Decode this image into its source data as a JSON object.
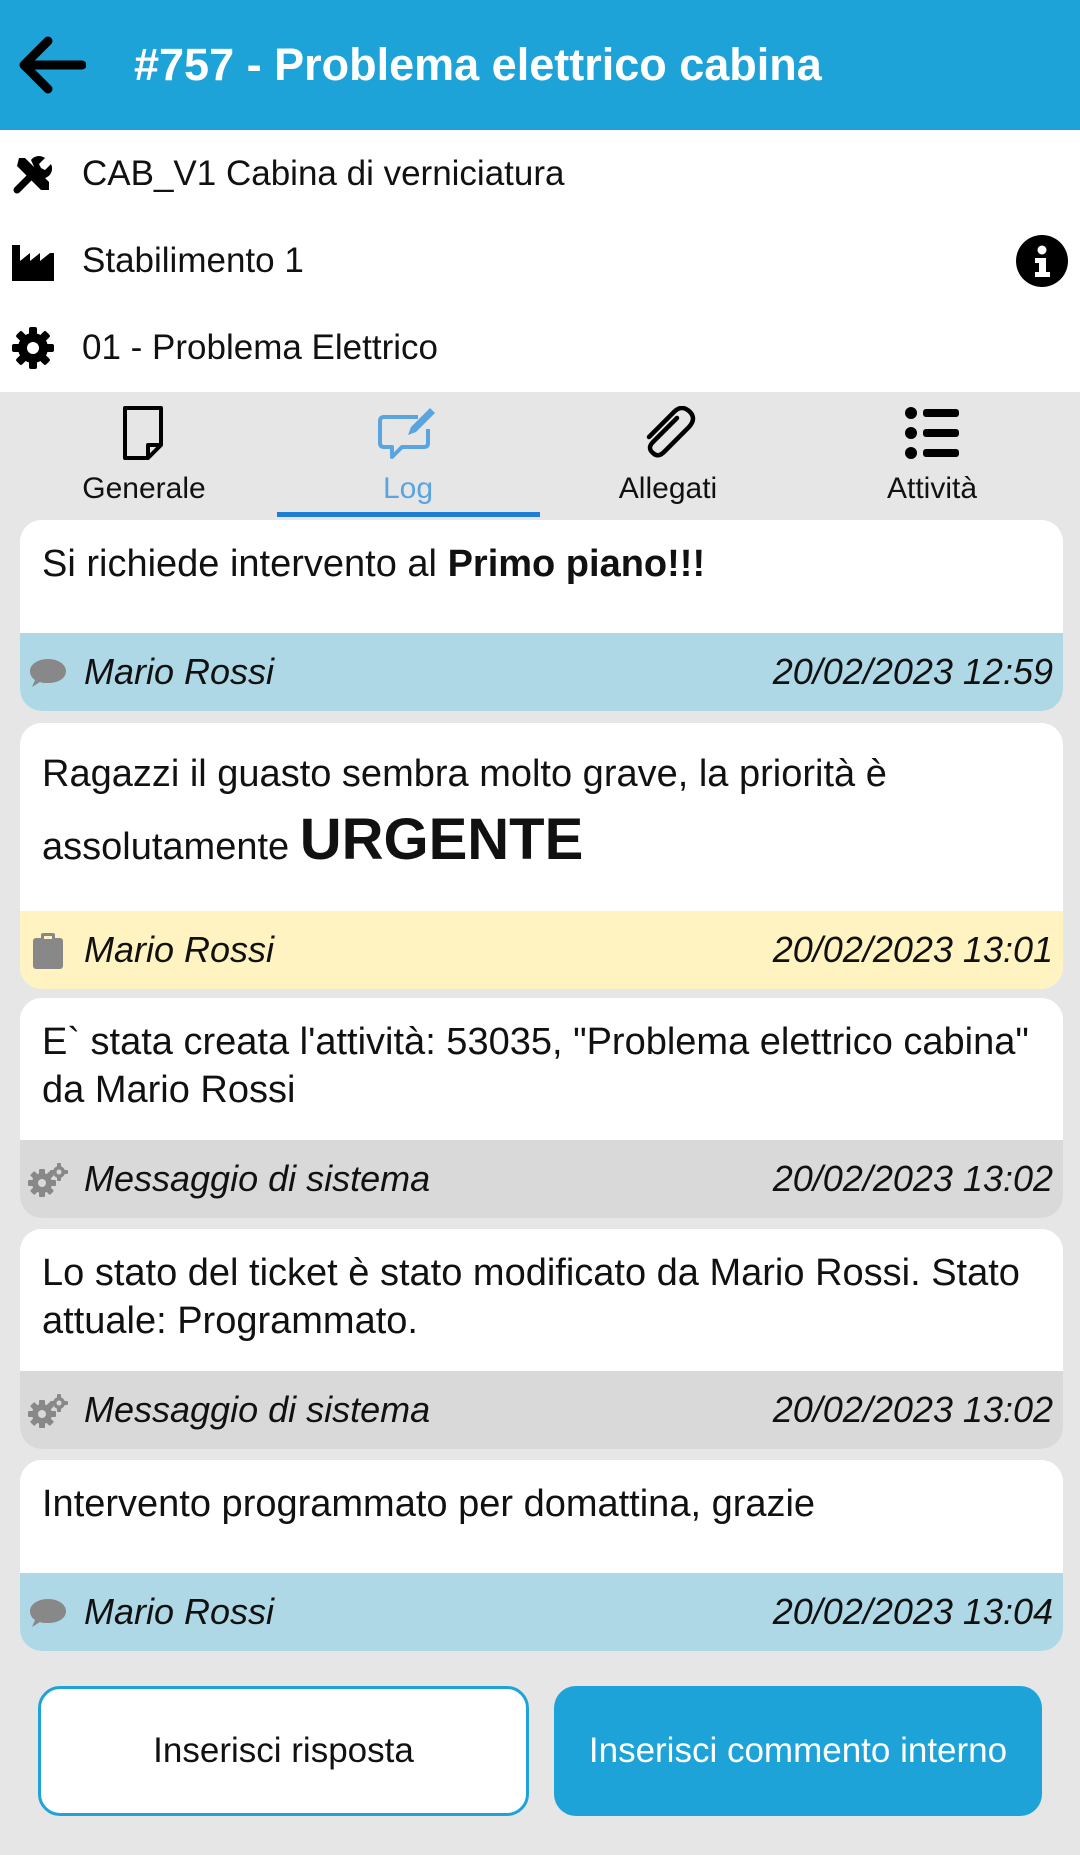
{
  "header": {
    "title": "#757 - Problema elettrico cabina"
  },
  "info": {
    "asset": "CAB_V1 Cabina di verniciatura",
    "plant": "Stabilimento 1",
    "category": "01 - Problema Elettrico"
  },
  "tabs": [
    {
      "label": "Generale"
    },
    {
      "label": "Log"
    },
    {
      "label": "Allegati"
    },
    {
      "label": "Attività"
    }
  ],
  "active_tab": "Log",
  "log": [
    {
      "pre": "Si richiede intervento al ",
      "emph": "Primo piano!!!",
      "author": "Mario Rossi",
      "time": "20/02/2023 12:59",
      "kind": "reply"
    },
    {
      "pre": "Ragazzi il guasto sembra molto grave, la priorità è assolutamente ",
      "emph": "URGENTE",
      "author": "Mario Rossi",
      "time": "20/02/2023 13:01",
      "kind": "internal-note"
    },
    {
      "text": "E` stata creata l'attività: 53035, \"Problema elettrico cabina\" da Mario Rossi",
      "author": "Messaggio di sistema",
      "time": "20/02/2023 13:02",
      "kind": "system"
    },
    {
      "text": "Lo stato del ticket è stato modificato da Mario Rossi. Stato attuale: Programmato.",
      "author": "Messaggio di sistema",
      "time": "20/02/2023 13:02",
      "kind": "system"
    },
    {
      "text": "Intervento programmato per domattina, grazie",
      "author": "Mario Rossi",
      "time": "20/02/2023 13:04",
      "kind": "reply"
    }
  ],
  "actions": {
    "reply_label": "Inserisci risposta",
    "comment_label": "Inserisci commento interno"
  },
  "colors": {
    "accent": "#1ea3d9",
    "reply_footer": "#aed8e6",
    "note_footer": "#fff3c2",
    "system_footer": "#d9d9d9",
    "active_tab": "#5aa4e0"
  },
  "icons": {
    "back": "arrow-left-icon",
    "asset": "tools-icon",
    "plant": "factory-icon",
    "category": "gear-icon",
    "info": "info-icon",
    "tab_general": "document-icon",
    "tab_log": "chat-edit-icon",
    "tab_attachments": "paperclip-icon",
    "tab_activities": "list-icon",
    "reply": "comment-icon",
    "note": "clipboard-icon",
    "system": "gears-icon"
  }
}
